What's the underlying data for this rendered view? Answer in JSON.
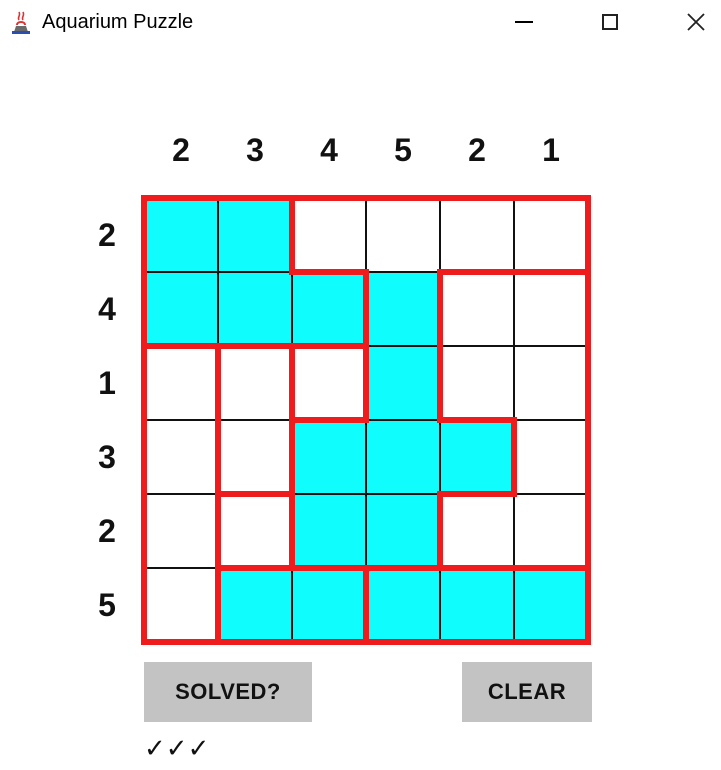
{
  "window": {
    "title": "Aquarium Puzzle",
    "minimize_glyph": "",
    "close_glyph": "✕"
  },
  "puzzle": {
    "col_clues": [
      "2",
      "3",
      "4",
      "5",
      "2",
      "1"
    ],
    "row_clues": [
      "2",
      "4",
      "1",
      "3",
      "2",
      "5"
    ],
    "filled": [
      [
        1,
        1,
        0,
        0,
        0,
        0
      ],
      [
        1,
        1,
        1,
        1,
        0,
        0
      ],
      [
        0,
        0,
        0,
        1,
        0,
        0
      ],
      [
        0,
        0,
        1,
        1,
        1,
        0
      ],
      [
        0,
        0,
        1,
        1,
        0,
        0
      ],
      [
        0,
        1,
        1,
        1,
        1,
        1
      ]
    ],
    "regions": [
      [
        0,
        0,
        1,
        1,
        1,
        1
      ],
      [
        0,
        0,
        0,
        1,
        2,
        2
      ],
      [
        3,
        4,
        5,
        1,
        2,
        2
      ],
      [
        3,
        4,
        1,
        1,
        1,
        2
      ],
      [
        3,
        6,
        1,
        1,
        2,
        2
      ],
      [
        3,
        7,
        7,
        8,
        8,
        8
      ]
    ],
    "water_color": "#10fdfd",
    "wall_color": "#ee1c1c"
  },
  "controls": {
    "solved_label": "SOLVED?",
    "clear_label": "CLEAR"
  },
  "status": {
    "text": "✓✓✓"
  }
}
